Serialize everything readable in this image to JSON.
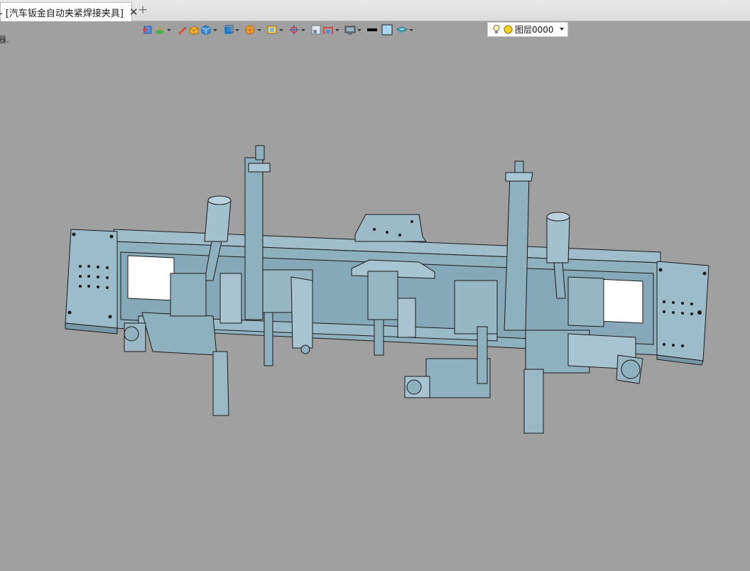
{
  "tabs": {
    "active_title": "- [汽车钣金自动夹紧焊接夹具]",
    "close_glyph": "✕",
    "add_glyph": "+"
  },
  "toolbar": {
    "icons": [
      "exit-sketch-icon",
      "draw-icon",
      "pencil-icon",
      "box-icon",
      "cube-icon",
      "view-cube-icon",
      "render-icon",
      "shade-icon",
      "point-icon",
      "section-icon",
      "dimension-icon",
      "display-icon",
      "line-color-icon",
      "face-color-icon",
      "layer-stack-icon"
    ],
    "layer": {
      "value": "图层0000"
    }
  },
  "side_text": "器.",
  "colors": {
    "background": "#a0a0a0",
    "part_fill": "#8fb0bf",
    "part_stroke": "#1a1a1a"
  }
}
